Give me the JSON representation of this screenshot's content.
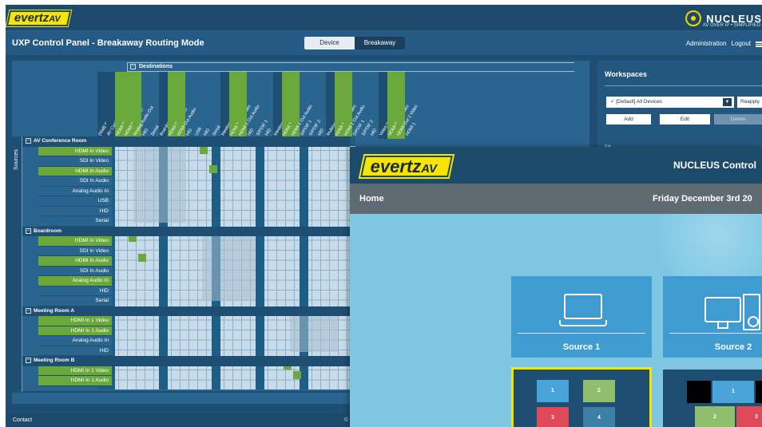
{
  "app": {
    "logo_text": "evertz",
    "logo_suffix": "AV",
    "brand_name": "NUCLEUS",
    "brand_tagline": "AV OVER IP • SIMPLIFIED",
    "page_title": "UXP Control Panel - Breakaway Routing Mode",
    "mode_tabs": [
      "Device",
      "Breakaway"
    ],
    "active_mode": "Breakaway",
    "nav": {
      "administration": "Administration",
      "logout": "Logout"
    }
  },
  "matrix": {
    "destinations_label": "Destinations",
    "sources_label": "Sources",
    "columns": [
      {
        "label": "(Wall) Reception V...",
        "group": true
      },
      {
        "label": "AV Conference Ro...",
        "group": true
      },
      {
        "label": "HDMI Out Video",
        "active": true
      },
      {
        "label": "HDMI Out Audio",
        "active": true
      },
      {
        "label": "Analog Audio Out",
        "active": true
      },
      {
        "label": "HID"
      },
      {
        "label": "Serial"
      },
      {
        "label": "Boardroom",
        "group": true
      },
      {
        "label": "HDMI Out Video",
        "active": true
      },
      {
        "label": "HDMI Out Audio",
        "active": true
      },
      {
        "label": "HID"
      },
      {
        "label": "USB"
      },
      {
        "label": "HID"
      },
      {
        "label": "Serial"
      },
      {
        "label": "Meeting Room A",
        "group": true
      },
      {
        "label": "HDMI 1 Out Video",
        "active": true
      },
      {
        "label": "HDMI 1 Out Audio",
        "active": true
      },
      {
        "label": "HID"
      },
      {
        "label": "S/PDIF 1"
      },
      {
        "label": "HID"
      },
      {
        "label": "Meeting Room B",
        "group": true
      },
      {
        "label": "HDMI 1 Video",
        "active": true
      },
      {
        "label": "HDMI 1 Out Audio",
        "active": true
      },
      {
        "label": "S/PDIF 1"
      },
      {
        "label": "S/PDIF 2"
      },
      {
        "label": "HID"
      },
      {
        "label": "Multimedia Room",
        "group": true
      },
      {
        "label": "HDMI 1 Out Video",
        "active": true
      },
      {
        "label": "HDMI 1 Out Audio",
        "active": true
      },
      {
        "label": "S/PDIF 1"
      },
      {
        "label": "S/PDIF 2"
      },
      {
        "label": "HID"
      },
      {
        "label": "Video Wall A",
        "group": true
      },
      {
        "label": "HDMI Out 1 Video",
        "active": true
      },
      {
        "label": "HDMI Out 2 Video",
        "active": true
      },
      {
        "label": "HDMI 1"
      }
    ],
    "groups": [
      {
        "name": "AV Conference Room",
        "rows": [
          {
            "label": "HDMI In Video",
            "active": true
          },
          {
            "label": "SDI In Video",
            "active": false
          },
          {
            "label": "HDMI In Audio",
            "active": true
          },
          {
            "label": "SDI In Audio",
            "active": false
          },
          {
            "label": "Analog Audio In",
            "active": false
          },
          {
            "label": "USB",
            "active": false
          },
          {
            "label": "HID",
            "active": false
          },
          {
            "label": "Serial",
            "active": false
          }
        ]
      },
      {
        "name": "Boardroom",
        "rows": [
          {
            "label": "HDMI In Video",
            "active": true
          },
          {
            "label": "SDI In Video",
            "active": false
          },
          {
            "label": "HDMI In Audio",
            "active": true
          },
          {
            "label": "SDI In Audio",
            "active": false
          },
          {
            "label": "Analog Audio In",
            "active": true
          },
          {
            "label": "HID",
            "active": false
          },
          {
            "label": "Serial",
            "active": false
          }
        ]
      },
      {
        "name": "Meeting Room A",
        "rows": [
          {
            "label": "HDMI In 1 Video",
            "active": true
          },
          {
            "label": "HDMI In 1 Audio",
            "active": true
          },
          {
            "label": "Analog Audio In",
            "active": false
          },
          {
            "label": "HID",
            "active": false
          }
        ]
      },
      {
        "name": "Meeting Room B",
        "rows": [
          {
            "label": "HDMI In 1 Video",
            "active": true
          },
          {
            "label": "HDMI In 1 Audio",
            "active": true
          }
        ]
      }
    ]
  },
  "workspaces": {
    "title": "Workspaces",
    "selected": "✓ [Default] All Devices",
    "reapply": "Reapply",
    "buttons": [
      "Add",
      "Edit",
      "Delete"
    ],
    "section_label": "Filt..."
  },
  "footer": {
    "contact": "Contact",
    "copyright": "©"
  },
  "nucleus_panel": {
    "logo_text": "evertz",
    "logo_suffix": "AV",
    "title": "NUCLEUS Control",
    "home": "Home",
    "date": "Friday December 3rd 20",
    "tiles": [
      {
        "label": "Source 1",
        "icon": "laptop-icon"
      },
      {
        "label": "Source 2",
        "icon": "desktop-icon"
      }
    ],
    "layout_tiles": [
      {
        "cells": [
          "1",
          "2",
          "3",
          "4"
        ]
      },
      {
        "cells": [
          "1",
          "2",
          "3"
        ]
      }
    ]
  }
}
